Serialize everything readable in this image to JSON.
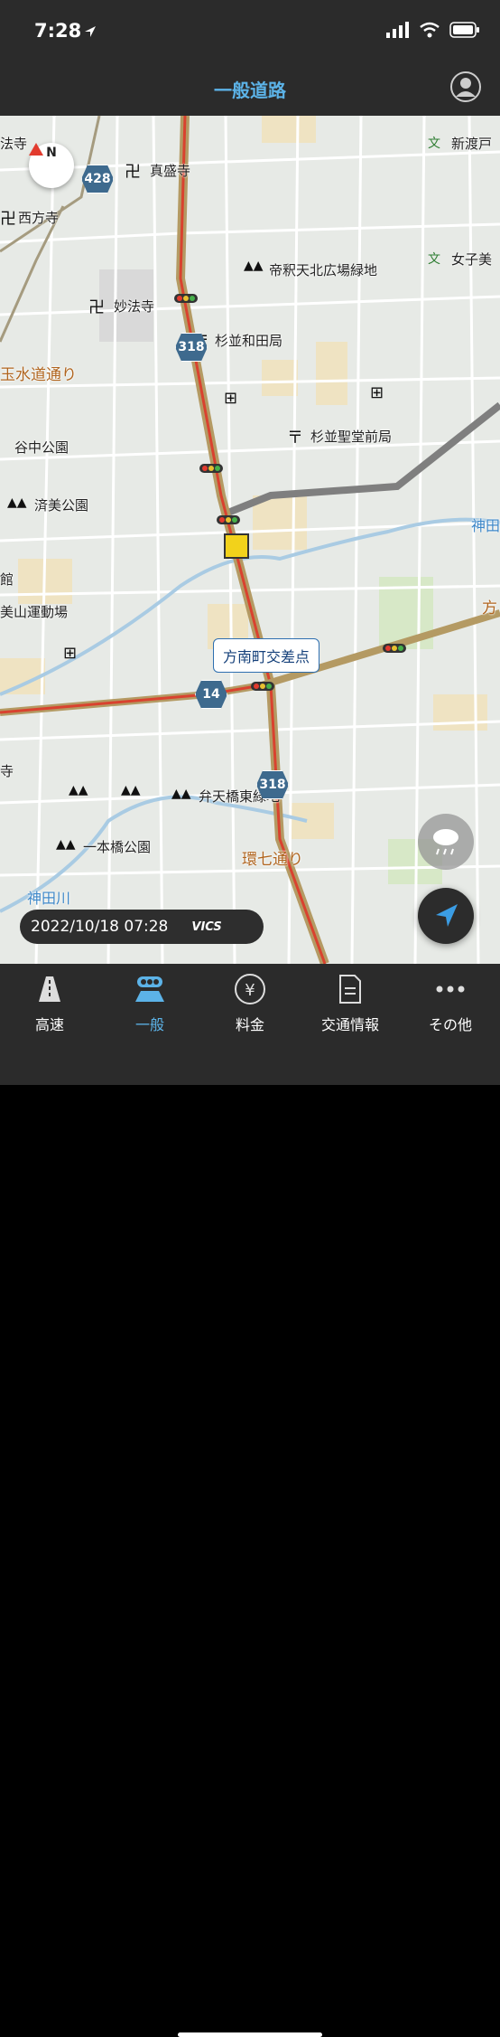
{
  "status": {
    "time": "7:28"
  },
  "header": {
    "title": "一般道路",
    "account_icon": "account-icon"
  },
  "map": {
    "compass_label": "N",
    "labels": [
      {
        "id": "hoshoji",
        "text": "法寺"
      },
      {
        "id": "shinseiji",
        "text": "真盛寺"
      },
      {
        "id": "saihoji",
        "text": "西方寺"
      },
      {
        "id": "myohoji",
        "text": "妙法寺"
      },
      {
        "id": "taishaku",
        "text": "帝釈天北広場緑地"
      },
      {
        "id": "suginami_wada",
        "text": "杉並和田局"
      },
      {
        "id": "suginami_seido",
        "text": "杉並聖堂前局"
      },
      {
        "id": "suido",
        "text": "玉水道通り"
      },
      {
        "id": "yanaka",
        "text": "谷中公園"
      },
      {
        "id": "saimi",
        "text": "済美公園"
      },
      {
        "id": "kan",
        "text": "館"
      },
      {
        "id": "biyama",
        "text": "美山運動場"
      },
      {
        "id": "shintoko",
        "text": "新渡戸"
      },
      {
        "id": "joshibi",
        "text": "女子美"
      },
      {
        "id": "kandagawa_r",
        "text": "神田"
      },
      {
        "id": "ho",
        "text": "方"
      },
      {
        "id": "ji",
        "text": "寺"
      },
      {
        "id": "bentenbashi",
        "text": "弁天橋東緑地"
      },
      {
        "id": "ipponbashi",
        "text": "一本橋公園"
      },
      {
        "id": "kannana",
        "text": "環七通り"
      },
      {
        "id": "kandagawa",
        "text": "神田川"
      }
    ],
    "shields": {
      "r428": "428",
      "r318a": "318",
      "r14": "14",
      "r318b": "318"
    },
    "callout": "方南町交差点",
    "timestamp": "2022/10/18 07:28",
    "vics": "VICS",
    "traffic_colors": {
      "red": "#e23b2e",
      "yellow": "#e8c030",
      "green": "#46b04a"
    }
  },
  "tabs": [
    {
      "label": "高速",
      "icon": "highway-icon"
    },
    {
      "label": "一般",
      "icon": "traffic-light-car-icon",
      "active": true
    },
    {
      "label": "料金",
      "icon": "yen-icon"
    },
    {
      "label": "交通情報",
      "icon": "document-icon"
    },
    {
      "label": "その他",
      "icon": "more-icon"
    }
  ]
}
